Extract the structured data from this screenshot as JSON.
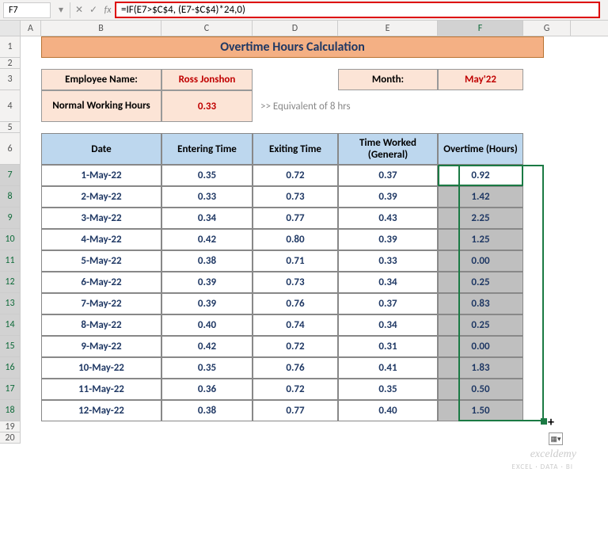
{
  "name_box": "F7",
  "formula": "=IF(E7>$C$4, (E7-$C$4)*24,0)",
  "columns": [
    "A",
    "B",
    "C",
    "D",
    "E",
    "F",
    "G"
  ],
  "rownums": [
    "1",
    "2",
    "3",
    "4",
    "5",
    "6",
    "7",
    "8",
    "9",
    "10",
    "11",
    "12",
    "13",
    "14",
    "15",
    "16",
    "17",
    "18",
    "19",
    "20"
  ],
  "title": "Overtime Hours Calculation",
  "info": {
    "emp_label": "Employee Name:",
    "emp_value": "Ross Jonshon",
    "month_label": "Month:",
    "month_value": "May'22",
    "hours_label": "Normal Working Hours",
    "hours_value": "0.33",
    "note": ">> Equivalent of 8 hrs"
  },
  "headers": {
    "date": "Date",
    "enter": "Entering Time",
    "exit": "Exiting Time",
    "worked": "Time Worked (General)",
    "ot": "Overtime (Hours)"
  },
  "chart_data": {
    "type": "table",
    "rows": [
      {
        "date": "1-May-22",
        "enter": "0.35",
        "exit": "0.72",
        "worked": "0.37",
        "ot": "0.92"
      },
      {
        "date": "2-May-22",
        "enter": "0.33",
        "exit": "0.73",
        "worked": "0.39",
        "ot": "1.42"
      },
      {
        "date": "3-May-22",
        "enter": "0.34",
        "exit": "0.77",
        "worked": "0.43",
        "ot": "2.25"
      },
      {
        "date": "4-May-22",
        "enter": "0.42",
        "exit": "0.80",
        "worked": "0.39",
        "ot": "1.25"
      },
      {
        "date": "5-May-22",
        "enter": "0.38",
        "exit": "0.71",
        "worked": "0.33",
        "ot": "0.00"
      },
      {
        "date": "6-May-22",
        "enter": "0.39",
        "exit": "0.73",
        "worked": "0.34",
        "ot": "0.25"
      },
      {
        "date": "7-May-22",
        "enter": "0.39",
        "exit": "0.76",
        "worked": "0.37",
        "ot": "0.83"
      },
      {
        "date": "8-May-22",
        "enter": "0.40",
        "exit": "0.74",
        "worked": "0.34",
        "ot": "0.25"
      },
      {
        "date": "9-May-22",
        "enter": "0.42",
        "exit": "0.72",
        "worked": "0.31",
        "ot": "0.00"
      },
      {
        "date": "10-May-22",
        "enter": "0.35",
        "exit": "0.76",
        "worked": "0.41",
        "ot": "1.83"
      },
      {
        "date": "11-May-22",
        "enter": "0.36",
        "exit": "0.72",
        "worked": "0.35",
        "ot": "0.50"
      },
      {
        "date": "12-May-22",
        "enter": "0.38",
        "exit": "0.77",
        "worked": "0.40",
        "ot": "1.50"
      }
    ]
  },
  "watermark": "exceldemy",
  "watermark_sub": "EXCEL · DATA · BI",
  "icons": {
    "dd": "▾",
    "fx": "fx",
    "x": "✕",
    "chk": "✓"
  }
}
